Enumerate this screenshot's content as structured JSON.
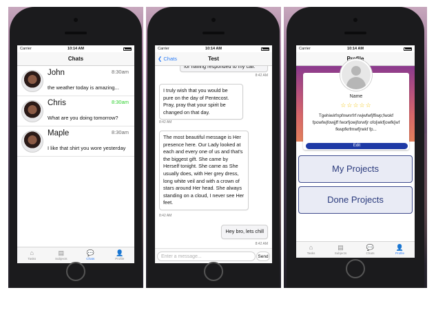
{
  "status": {
    "carrier": "Carrier",
    "time": "10:14 AM"
  },
  "tabs": {
    "tasks": "Tasks",
    "subjects": "Subjects",
    "chats": "Chats",
    "profile": "Profile"
  },
  "chats_screen": {
    "title": "Chats",
    "items": [
      {
        "name": "John",
        "time": "8:30am",
        "preview": "the weather today is amazing...",
        "time_color": "#666666"
      },
      {
        "name": "Chris",
        "time": "8:30am",
        "preview": "What are you doing tomorrow?",
        "time_color": "#2bd02b"
      },
      {
        "name": "Maple",
        "time": "8:30am",
        "preview": "I like that shirt you wore yesterday"
      }
    ]
  },
  "message_screen": {
    "back_label": "Chats",
    "title": "Test",
    "messages": [
      {
        "text": "for having responded to my call.",
        "time": "8:42 AM",
        "outgoing": true
      },
      {
        "text": "I truly wish that you would be pure on the day of Pentecost. Pray, pray that your spirit be changed on that day.",
        "time": "8:42 AM",
        "outgoing": false
      },
      {
        "text": "The most beautiful message is Her presence here. Our Lady looked at each and every one of us and that's the biggest gift. She came by Herself tonight. She came as She usually does, with Her grey dress, long white veil and with a crown of stars around Her head. She always standing on a cloud, I never see Her feet.",
        "time": "8:42 AM",
        "outgoing": false
      },
      {
        "text": "Hey bro, lets chill",
        "time": "8:42 AM",
        "outgoing": true
      }
    ],
    "input_placeholder": "Enter a message...",
    "send_label": "Send"
  },
  "profile_screen": {
    "title": "Profile",
    "name": "Name",
    "rating": "☆☆☆☆☆",
    "bio": "Tgehiwirfnpfnwnrfrf rwjwfwfjffiwp;fwokf fpowfwjfowjjff fworfjowjforwfjr ofo[wkf[owfk[wf fkwpfkrfmwf[rwkf fp...",
    "edit_label": "Edit",
    "buttons": {
      "my_projects": "My Projects",
      "done_projects": "Done Projects"
    }
  }
}
